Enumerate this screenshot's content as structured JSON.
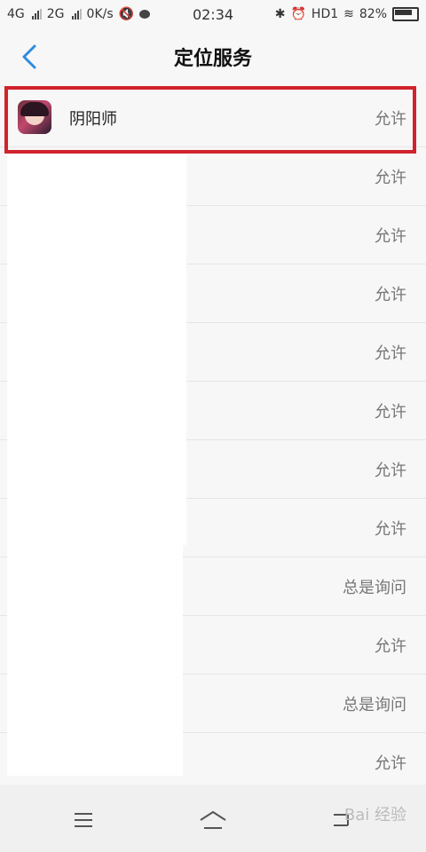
{
  "status_bar": {
    "net1": "4G",
    "net2": "2G",
    "speed": "0K/s",
    "time": "02:34",
    "hd": "HD1",
    "battery": "82%"
  },
  "header": {
    "title": "定位服务"
  },
  "apps": [
    {
      "name": "阴阳师",
      "permission": "允许"
    },
    {
      "name": "",
      "permission": "允许"
    },
    {
      "name": "",
      "permission": "允许"
    },
    {
      "name": "",
      "permission": "允许"
    },
    {
      "name": "",
      "permission": "允许"
    },
    {
      "name": "",
      "permission": "允许"
    },
    {
      "name": "",
      "permission": "允许"
    },
    {
      "name": "",
      "permission": "允许"
    },
    {
      "name": "",
      "permission": "总是询问"
    },
    {
      "name": "",
      "permission": "允许"
    },
    {
      "name": "",
      "permission": "总是询问"
    },
    {
      "name": "",
      "permission": "允许"
    }
  ],
  "watermark": "Bai 经验",
  "colors": {
    "accent": "#2f8be0",
    "highlight": "#d0232c"
  },
  "icons": {
    "back": "chevron-left-icon",
    "menu": "menu-icon",
    "home": "home-icon",
    "nav_back": "back-icon"
  }
}
